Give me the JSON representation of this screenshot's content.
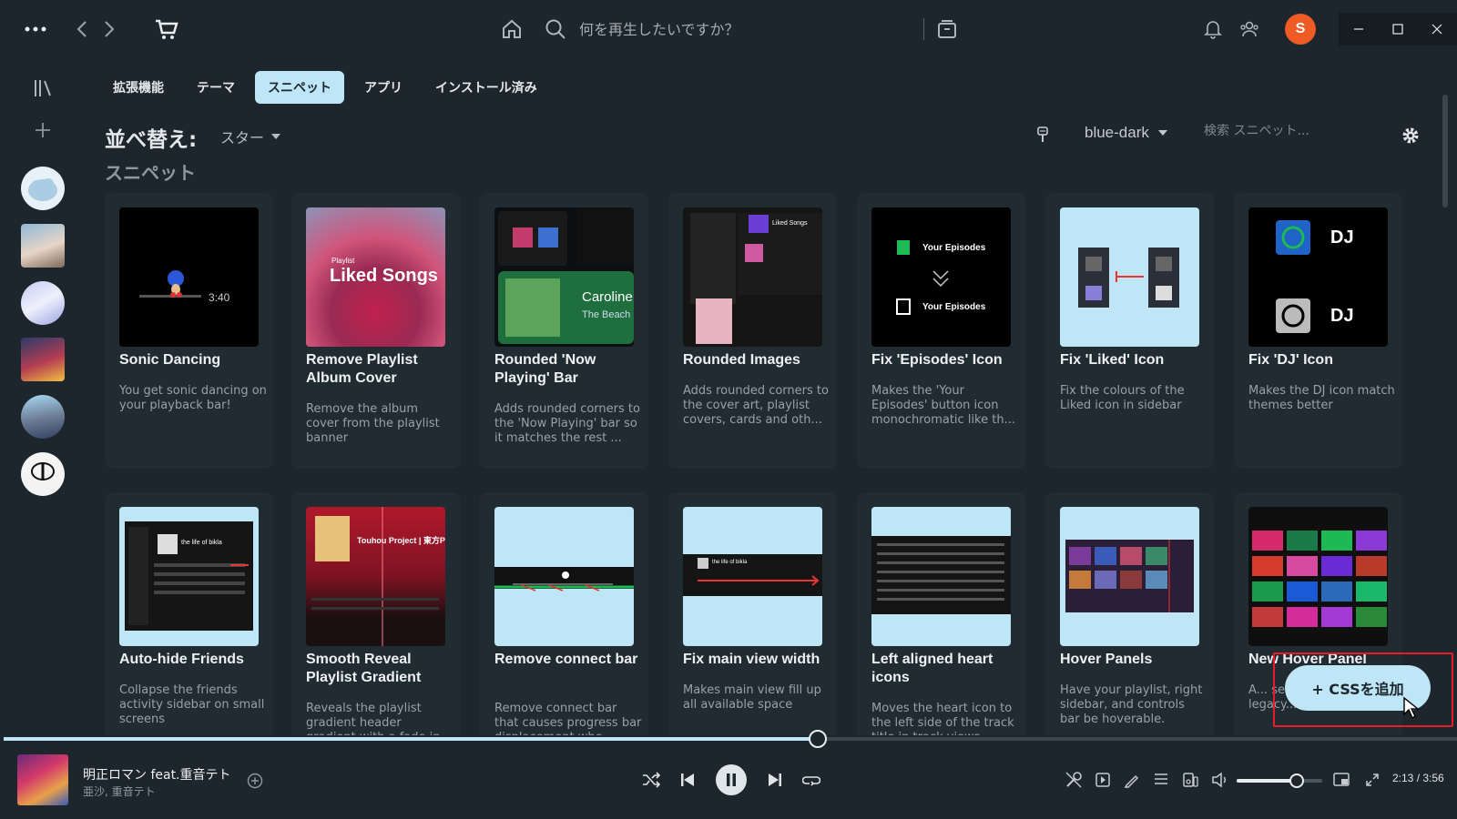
{
  "colors": {
    "bg": "#1d262c",
    "card": "#212b32",
    "accent": "#bfe6f7",
    "avatar": "#ef5b24",
    "highlight": "#e81b2b"
  },
  "topbar": {
    "more_icon": "more-dots-icon",
    "search_placeholder": "何を再生したいですか？",
    "avatar_letter": "S"
  },
  "sidebar": {
    "library_icon": "library-icon",
    "add_icon": "plus-icon"
  },
  "tabs": [
    {
      "label": "拡張機能",
      "active": false
    },
    {
      "label": "テーマ",
      "active": false
    },
    {
      "label": "スニペット",
      "active": true
    },
    {
      "label": "アプリ",
      "active": false
    },
    {
      "label": "インストール済み",
      "active": false
    }
  ],
  "sort": {
    "label": "並べ替え:",
    "value": "スター"
  },
  "section_title": "スニペット",
  "theme": {
    "value": "blue-dark",
    "search_placeholder": "検索 スニペット..."
  },
  "cards": [
    {
      "title": "Sonic Dancing",
      "desc": "You get sonic dancing on your playback bar!",
      "thumb_text": "3:40"
    },
    {
      "title": "Remove Playlist Album Cover",
      "desc": "Remove the album cover from the playlist banner",
      "thumb_kicker": "Playlist",
      "thumb_text": "Liked Songs"
    },
    {
      "title": "Rounded 'Now Playing' Bar",
      "desc": "Adds rounded corners to the 'Now Playing' bar so it matches the rest ...",
      "thumb_text": "Caroline",
      "thumb_sub": "The Beach"
    },
    {
      "title": "Rounded Images",
      "desc": "Adds rounded corners to the cover art, playlist covers, cards and oth...",
      "thumb_text": "Liked Songs"
    },
    {
      "title": "Fix 'Episodes' Icon",
      "desc": "Makes the 'Your Episodes' button icon monochromatic like th...",
      "thumb_text": "Your Episodes"
    },
    {
      "title": "Fix 'Liked' Icon",
      "desc": "Fix the colours of the Liked icon in sidebar"
    },
    {
      "title": "Fix 'DJ' Icon",
      "desc": "Makes the DJ icon match themes better",
      "thumb_text": "DJ"
    },
    {
      "title": "Auto-hide Friends",
      "desc": "Collapse the friends activity sidebar on small screens",
      "thumb_text": "the life of bikla"
    },
    {
      "title": "Smooth Reveal Playlist Gradient",
      "desc": "Reveals the playlist gradient header gradient with a fade in",
      "thumb_text": "Touhou Project | 東方Project"
    },
    {
      "title": "Remove connect bar",
      "desc": "Remove connect bar that causes progress bar displacement whe..."
    },
    {
      "title": "Fix main view width",
      "desc": "Makes main view fill up all available space",
      "thumb_text": "the life of bikla"
    },
    {
      "title": "Left aligned heart icons",
      "desc": "Moves the heart icon to the left side of the track title in track views"
    },
    {
      "title": "Hover Panels",
      "desc": "Have your playlist, right sidebar, and controls bar be hoverable."
    },
    {
      "title": "New Hover Panel",
      "desc": "A... se... purpose as the legacy..."
    }
  ],
  "add_css_label": "+ CSSを追加",
  "player": {
    "title": "明正ロマン feat.重音テト",
    "artist": "亜沙, 重音テト",
    "time": "2:13 / 3:56",
    "progress": 0.56,
    "volume": 0.7
  }
}
